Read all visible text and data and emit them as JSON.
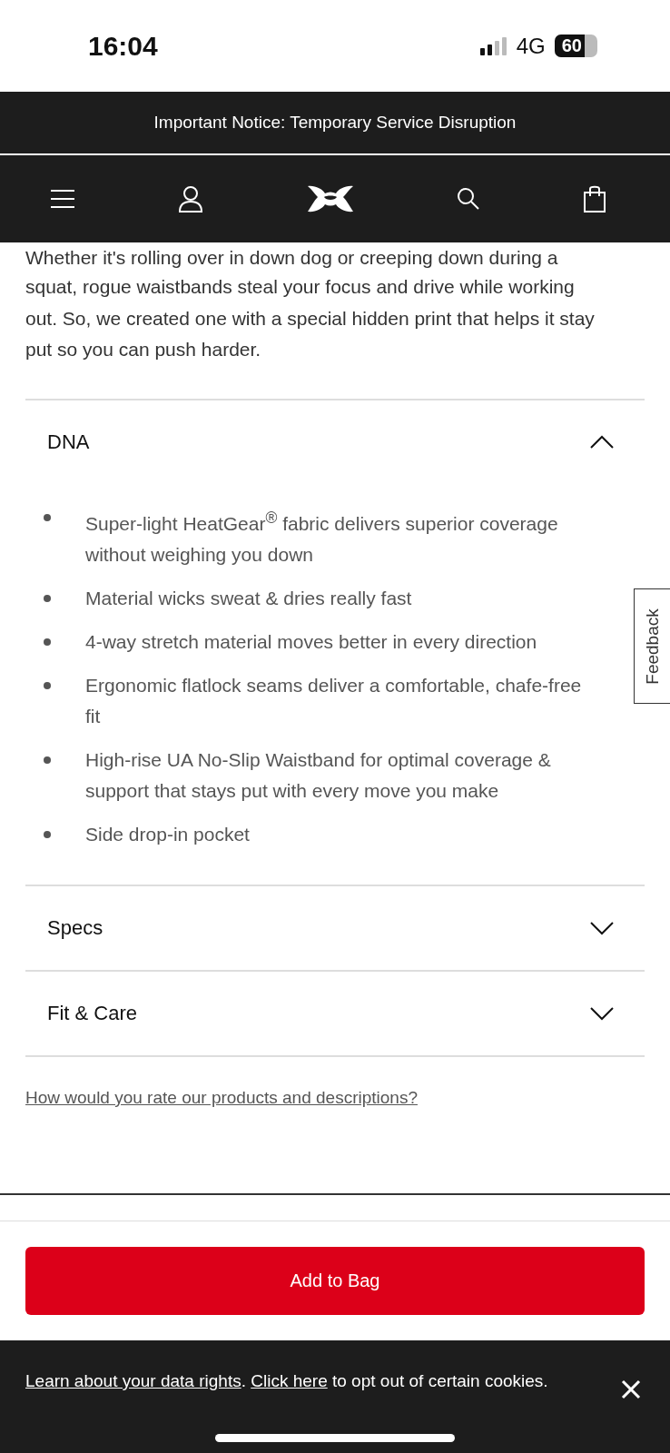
{
  "status_bar": {
    "time": "16:04",
    "network": "4G",
    "battery": "60"
  },
  "notice": {
    "text": "Important Notice: Temporary Service Disruption"
  },
  "description": {
    "cut_line": "Whether it's rolling over in down dog or creeping down during a",
    "text": "squat, rogue waistbands steal your focus and drive while working out. So, we created one with a special hidden print that helps it stay put so you can push harder."
  },
  "sections": [
    {
      "title": "DNA",
      "expanded": true,
      "bullets": [
        "Super-light HeatGear$^{®}$ fabric delivers superior coverage without weighing you down",
        "Material wicks sweat & dries really fast",
        "4-way stretch material moves better in every direction",
        "Ergonomic flatlock seams deliver a comfortable, chafe-free fit",
        "High-rise UA No-Slip Waistband for optimal coverage & support that stays put with every move you make",
        "Side drop-in pocket"
      ]
    },
    {
      "title": "Specs",
      "expanded": false
    },
    {
      "title": "Fit & Care",
      "expanded": false
    }
  ],
  "feedback_tab": "Feedback",
  "rating_link": "How would you rate our products and descriptions?",
  "add_to_bag": "Add to Bag",
  "cookie_banner": {
    "link_1": "Learn about your data rights",
    "separator": ".",
    "link_2": "Click here",
    "text": "to opt out of certain cookies."
  }
}
